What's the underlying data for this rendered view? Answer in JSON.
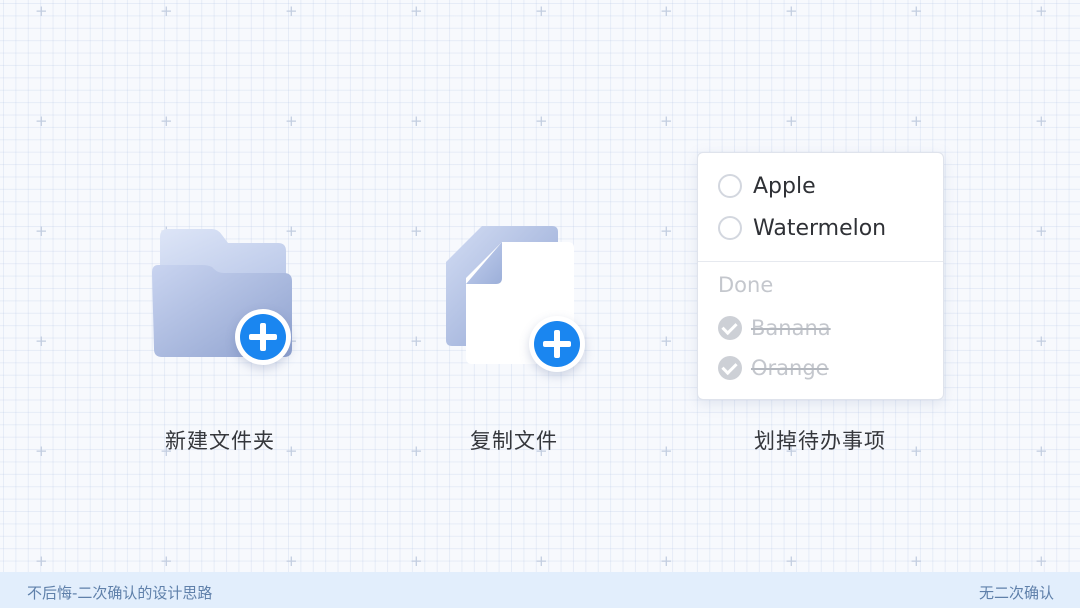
{
  "items": [
    {
      "label": "新建文件夹",
      "icon": "folder-add-icon"
    },
    {
      "label": "复制文件",
      "icon": "file-copy-icon"
    },
    {
      "label": "划掉待办事项",
      "icon": "todo-list-icon"
    }
  ],
  "todo": {
    "pending": [
      "Apple",
      "Watermelon"
    ],
    "done_heading": "Done",
    "done": [
      "Banana",
      "Orange"
    ]
  },
  "footer": {
    "left": "不后悔-二次确认的设计思路",
    "right": "无二次确认"
  },
  "colors": {
    "accent": "#1a86f0",
    "background": "#f7f9fd",
    "footer_band": "#e2eefc",
    "folder_light": "#d7e0f5",
    "folder_dark": "#98a9d2"
  }
}
